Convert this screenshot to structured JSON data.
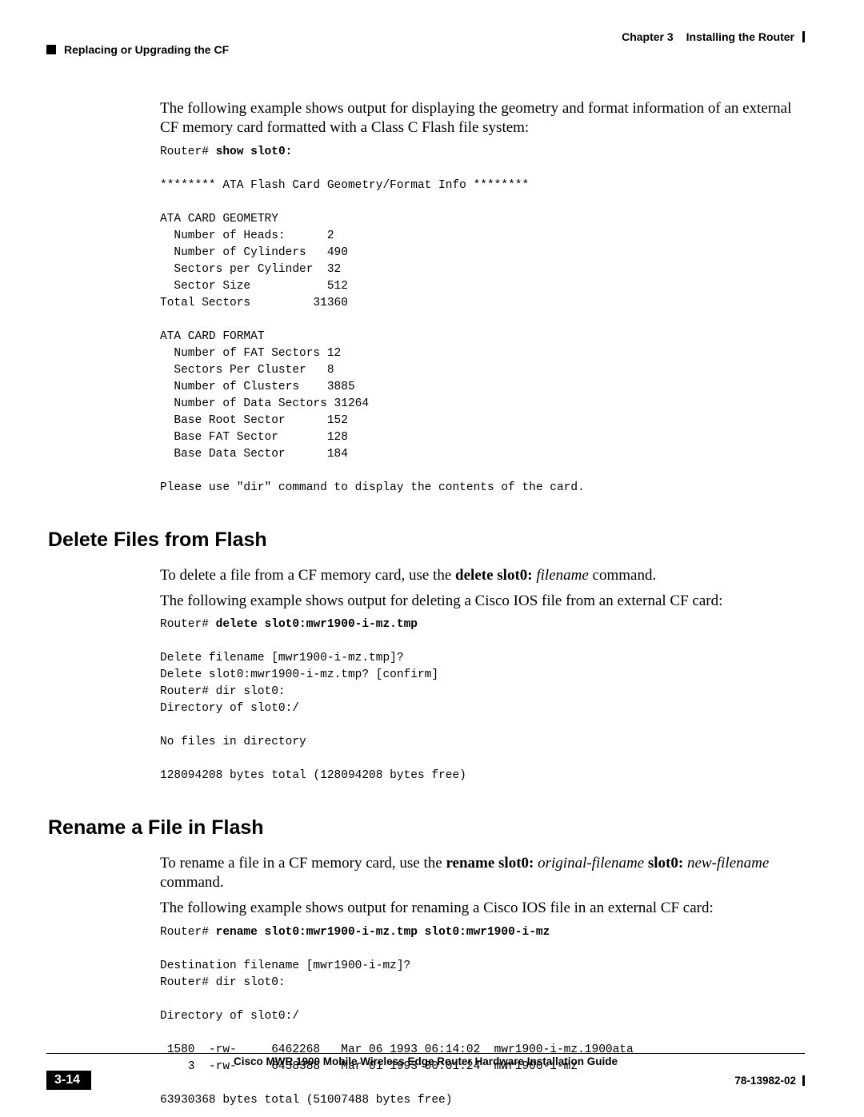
{
  "header": {
    "chapter_label": "Chapter 3",
    "chapter_title": "Installing the Router",
    "section_title": "Replacing or Upgrading the CF"
  },
  "intro_para": "The following example shows output for displaying the geometry and format information of an external CF memory card formatted with a Class C Flash file system:",
  "code1": {
    "prompt": "Router# ",
    "cmd": "show slot0:",
    "output": "\n******** ATA Flash Card Geometry/Format Info ********\n\nATA CARD GEOMETRY\n  Number of Heads:      2     \n  Number of Cylinders   490   \n  Sectors per Cylinder  32    \n  Sector Size           512   \nTotal Sectors         31360 \n\nATA CARD FORMAT\n  Number of FAT Sectors 12    \n  Sectors Per Cluster   8     \n  Number of Clusters    3885  \n  Number of Data Sectors 31264 \n  Base Root Sector      152   \n  Base FAT Sector       128   \n  Base Data Sector      184   \n\nPlease use \"dir\" command to display the contents of the card."
  },
  "section2": {
    "heading": "Delete Files from Flash",
    "para1_pre": "To delete a file from a CF memory card, use the ",
    "para1_cmd": "delete slot0:",
    "para1_arg": " filename",
    "para1_post": " command.",
    "para2": "The following example shows output for deleting a Cisco IOS file from an external CF card:",
    "code": {
      "prompt": "Router# ",
      "cmd": "delete slot0:mwr1900-i-mz.tmp",
      "output": "\nDelete filename [mwr1900-i-mz.tmp]?\nDelete slot0:mwr1900-i-mz.tmp? [confirm]\nRouter# dir slot0:\nDirectory of slot0:/\n\nNo files in directory\n\n128094208 bytes total (128094208 bytes free)"
    }
  },
  "section3": {
    "heading": "Rename a File in Flash",
    "para1_pre": "To rename a file in a CF memory card, use the ",
    "para1_cmd": "rename slot0:",
    "para1_arg1": " original-filename",
    "para1_mid": " slot0:",
    "para1_arg2": " new-filename",
    "para1_post": " command.",
    "para2": "The following example shows output for renaming a Cisco IOS file in an external CF card:",
    "code": {
      "prompt": "Router# ",
      "cmd": "rename slot0:mwr1900-i-mz.tmp slot0:mwr1900-i-mz",
      "output": "\nDestination filename [mwr1900-i-mz]?\nRouter# dir slot0:\n\nDirectory of slot0:/\n\n 1580  -rw-     6462268   Mar 06 1993 06:14:02  mwr1900-i-mz.1900ata\n    3  -rw-     6458388   Mar 01 1993 00:01:24  mwr1900-i-mz\n\n63930368 bytes total (51007488 bytes free)"
    }
  },
  "footer": {
    "guide_title": "Cisco MWR 1900 Mobile Wireless Edge Router Hardware Installation Guide",
    "page_number": "3-14",
    "doc_number": "78-13982-02"
  }
}
